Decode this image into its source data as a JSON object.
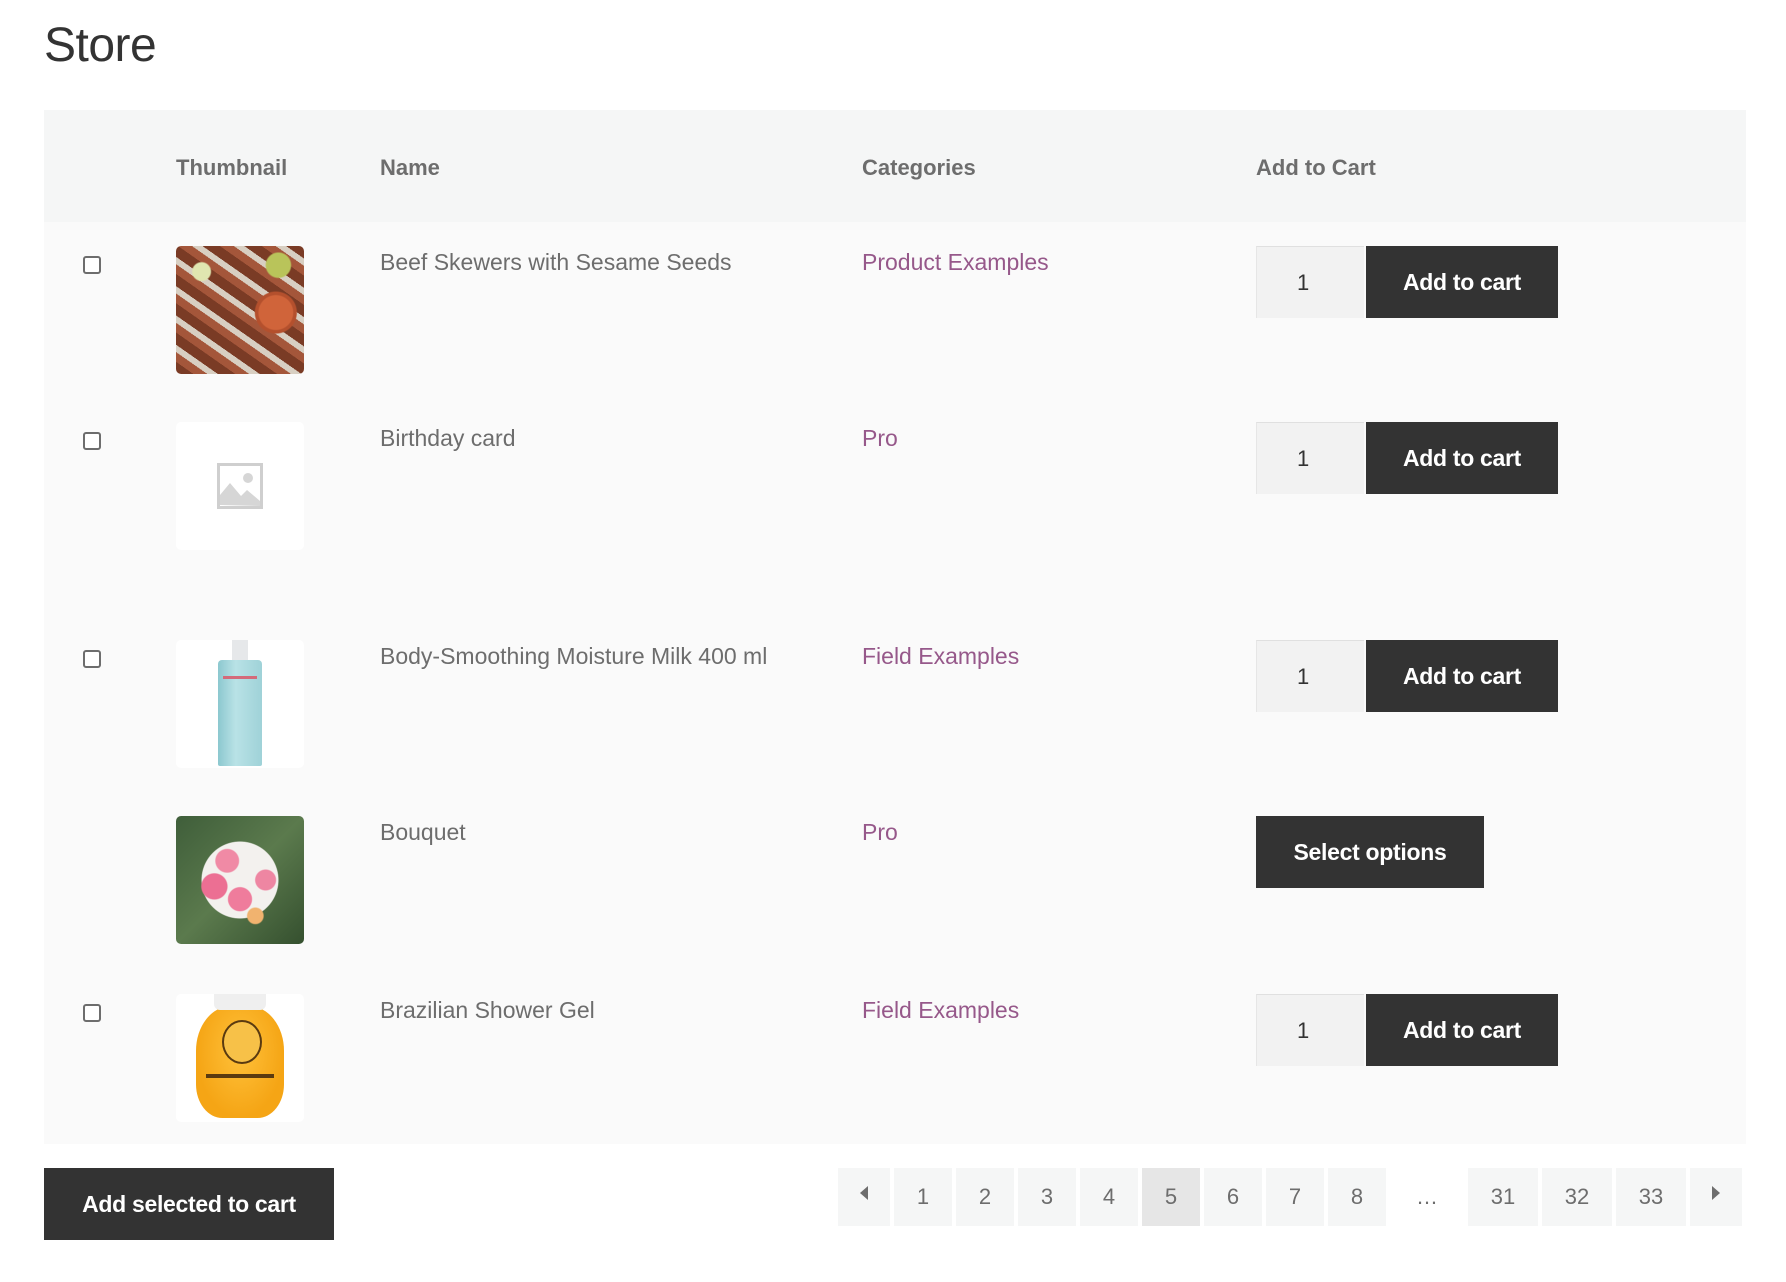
{
  "page": {
    "title": "Store"
  },
  "table": {
    "headers": {
      "thumbnail": "Thumbnail",
      "name": "Name",
      "categories": "Categories",
      "add_to_cart": "Add to Cart"
    },
    "rows": [
      {
        "selectable": true,
        "thumbnail": "beef-skewers-image",
        "name": "Beef Skewers with Sesame Seeds",
        "category": "Product Examples",
        "quantity": "1",
        "action": "Add to cart"
      },
      {
        "selectable": true,
        "thumbnail": "placeholder-image",
        "name": "Birthday card",
        "category": "Pro",
        "quantity": "1",
        "action": "Add to cart"
      },
      {
        "selectable": true,
        "thumbnail": "moisture-milk-bottle-image",
        "name": "Body-Smoothing Moisture Milk 400 ml",
        "category": "Field Examples",
        "quantity": "1",
        "action": "Add to cart"
      },
      {
        "selectable": false,
        "thumbnail": "bouquet-image",
        "name": "Bouquet",
        "category": "Pro",
        "action": "Select options"
      },
      {
        "selectable": true,
        "thumbnail": "shower-gel-bottle-image",
        "name": "Brazilian Shower Gel",
        "category": "Field Examples",
        "quantity": "1",
        "action": "Add to cart"
      }
    ]
  },
  "footer": {
    "bulk_button": "Add selected to cart"
  },
  "pagination": {
    "prev_icon": "caret-left",
    "next_icon": "caret-right",
    "pages": [
      "1",
      "2",
      "3",
      "4",
      "5",
      "6",
      "7",
      "8",
      "…",
      "31",
      "32",
      "33"
    ],
    "current": "5"
  },
  "colors": {
    "button": "#333333",
    "link": "#96588a",
    "header_bg": "#f5f6f6",
    "row_bg": "#fafafa",
    "active_page": "#e6e6e6"
  }
}
